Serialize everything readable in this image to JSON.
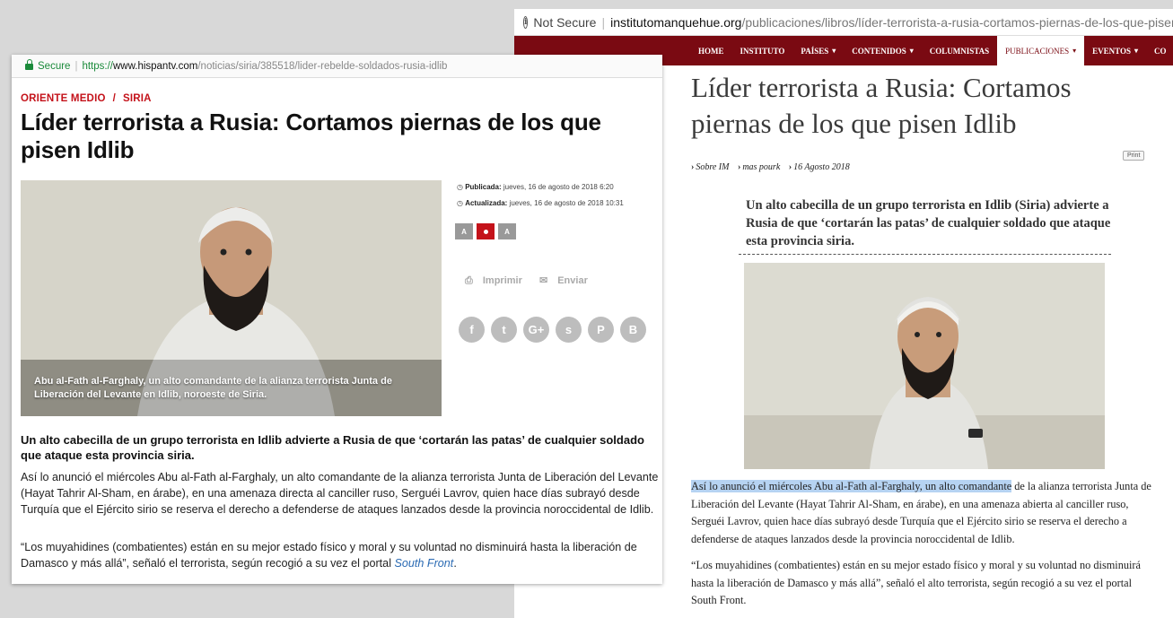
{
  "right_window": {
    "address": {
      "not_secure": "Not Secure",
      "separator": "|",
      "domain": "institutomanquehue.org",
      "path": "/publicaciones/libros/líder-terrorista-a-rusia-cortamos-piernas-de-los-que-pisen"
    },
    "nav": [
      {
        "label": "HOME",
        "dropdown": ""
      },
      {
        "label": "INSTITUTO",
        "dropdown": ""
      },
      {
        "label": "PAÍSES",
        "dropdown": "▾"
      },
      {
        "label": "CONTENIDOS",
        "dropdown": "▾"
      },
      {
        "label": "COLUMNISTAS",
        "dropdown": ""
      },
      {
        "label": "PUBLICACIONES",
        "dropdown": "▾"
      },
      {
        "label": "EVENTOS",
        "dropdown": "▾"
      },
      {
        "label": "CO",
        "dropdown": ""
      }
    ],
    "title": "Líder terrorista a Rusia: Cortamos piernas de los que pisen Idlib",
    "breadcrumbs": [
      "Sobre IM",
      "mas pourk",
      "16 Agosto 2018"
    ],
    "print_label": "Print",
    "lead": "Un alto cabecilla de un grupo terrorista en Idlib (Siria) advierte a Rusia de que ‘cortarán las patas’ de cualquier soldado que ataque esta provincia siria.",
    "p1_highlight": "Así lo anunció el miércoles Abu al-Fath al-Farghaly, un alto comandante",
    "p1_rest": " de la alianza terrorista Junta de Liberación del Levante (Hayat Tahrir Al-Sham, en árabe), en una amenaza abierta al canciller ruso, Serguéi Lavrov, quien hace días subrayó desde Turquía que el Ejército sirio se reserva el derecho a defenderse de ataques lanzados desde la provincia noroccidental de Idlib.",
    "p2": "“Los muyahidines (combatientes) están en su mejor estado físico y moral y su voluntad no disminuirá hasta la liberación de Damasco y más allá”, señaló el alto terrorista, según recogió a su vez el portal South Front."
  },
  "left_window": {
    "address": {
      "secure": "Secure",
      "separator": "|",
      "https": "https://",
      "domain": "www.hispantv.com",
      "path": "/noticias/siria/385518/lider-rebelde-soldados-rusia-idlib"
    },
    "section": "ORIENTE MEDIO",
    "section_sep": "/",
    "subsection": "SIRIA",
    "title": "Líder terrorista a Rusia: Cortamos piernas de los que pisen Idlib",
    "caption": "Abu al-Fath al-Farghaly, un alto comandante de la alianza terrorista Junta de Liberación del Levante en Idlib, noroeste de Siria.",
    "published_label": "Publicada:",
    "published_value": " jueves, 16 de agosto de 2018 6:20",
    "updated_label": "Actualizada:",
    "updated_value": " jueves, 16 de agosto de 2018 10:31",
    "font_buttons": [
      "A",
      "",
      "A"
    ],
    "print": "Imprimir",
    "send": "Enviar",
    "social": [
      "f",
      "t",
      "G+",
      "s",
      "P",
      "B"
    ],
    "lead": "Un alto cabecilla de un grupo terrorista en Idlib advierte a Rusia de que ‘cortarán las patas’ de cualquier soldado que ataque esta provincia siria.",
    "p1": "Así lo anunció el miércoles Abu al-Fath al-Farghaly, un alto comandante de la alianza terrorista Junta de Liberación del Levante (Hayat Tahrir Al-Sham, en árabe), en una amenaza directa al canciller ruso, Serguéi Lavrov, quien hace días subrayó desde Turquía que el Ejército sirio se reserva el derecho a defenderse de ataques lanzados desde la provincia noroccidental de Idlib.",
    "p2_text": "“Los muyahidines (combatientes) están en su mejor estado físico y moral y su voluntad no disminuirá hasta la liberación de Damasco y más allá”, señaló el terrorista, según recogió a su vez el portal ",
    "p2_link": "South Front",
    "p2_end": "."
  },
  "colors": {
    "nav_bg": "#7a0a12",
    "section_red": "#c4121a",
    "secure_green": "#1a8a3a",
    "highlight": "#b6d3f2",
    "link": "#2a6ab3"
  }
}
